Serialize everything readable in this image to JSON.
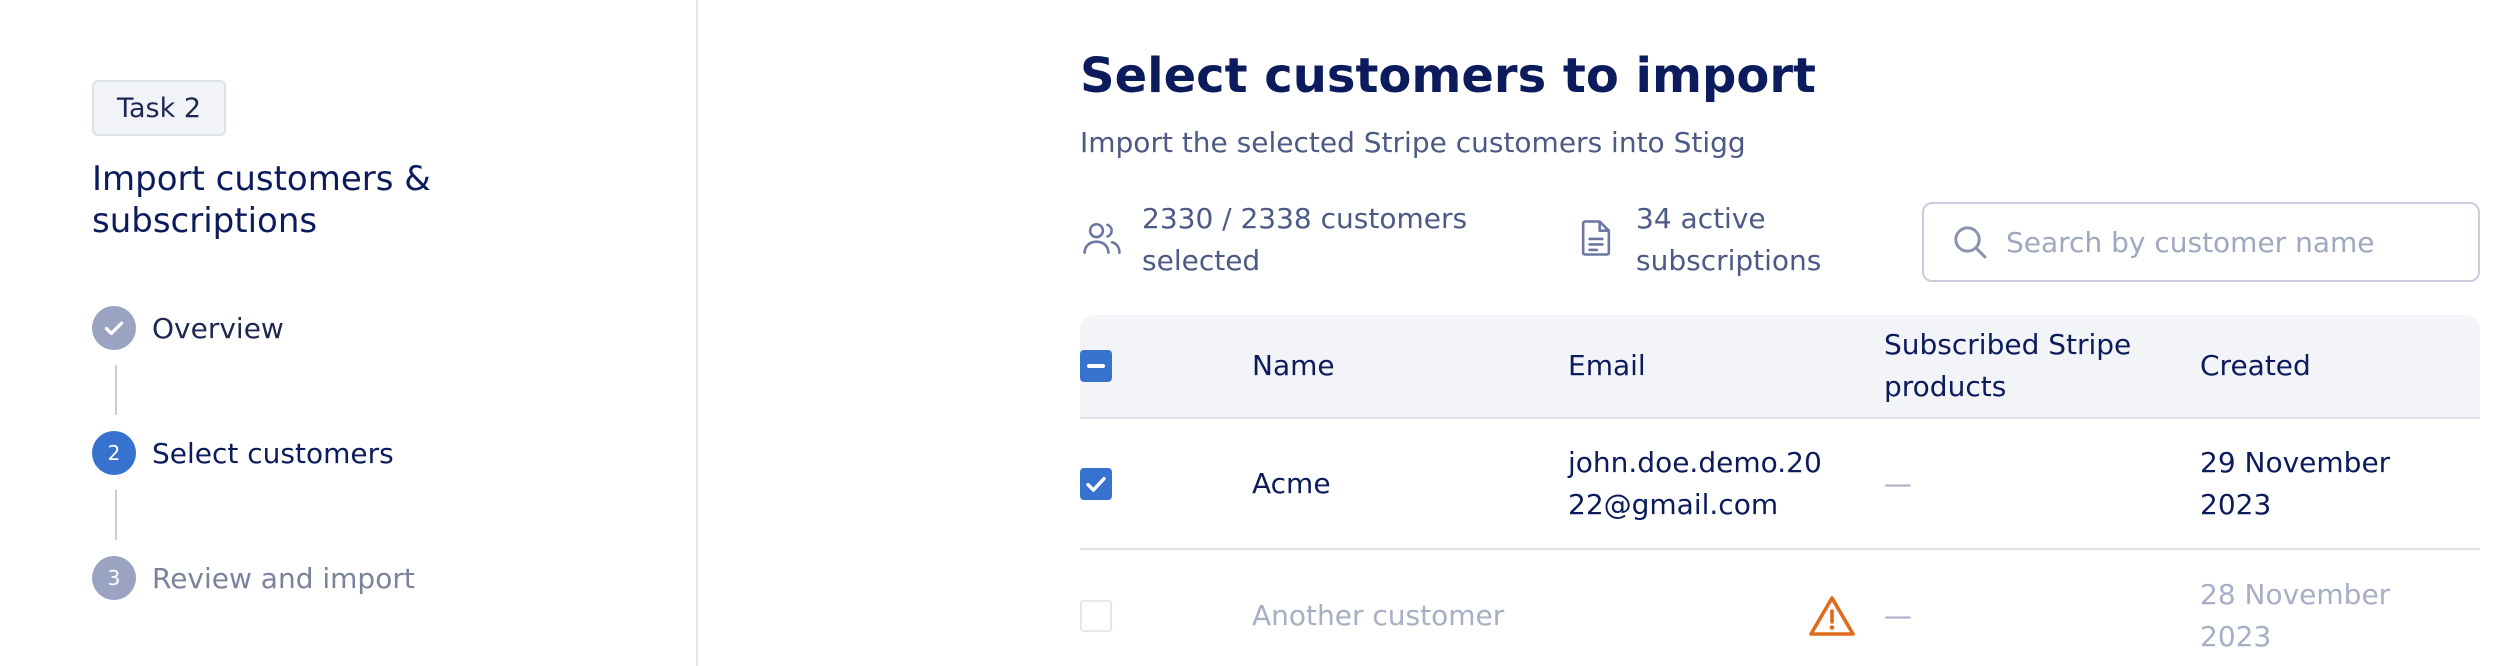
{
  "sidebar": {
    "task_badge": "Task 2",
    "task_title": "Import customers & subscriptions",
    "steps": [
      {
        "number": "",
        "label": "Overview",
        "status": "completed"
      },
      {
        "number": "2",
        "label": "Select customers",
        "status": "active"
      },
      {
        "number": "3",
        "label": "Review and import",
        "status": "pending"
      }
    ]
  },
  "main": {
    "title": "Select customers to import",
    "subtitle": "Import the selected Stripe customers into Stigg",
    "stats": {
      "customers": "2330 / 2338 customers selected",
      "subscriptions": "34 active subscriptions"
    },
    "search": {
      "placeholder": "Search by customer name",
      "value": ""
    }
  },
  "table": {
    "columns": [
      "Name",
      "Email",
      "Subscribed Stripe products",
      "Created"
    ],
    "rows": [
      {
        "name": "Acme",
        "email": "john.doe.demo.2022@gmail.com",
        "products": "—",
        "created": "29 November 2023",
        "checked": true,
        "disabled": false
      },
      {
        "name": "Another customer",
        "email": "",
        "products": "—",
        "created": "28 November 2023",
        "checked": false,
        "disabled": true,
        "warning": "warning-icon"
      }
    ]
  },
  "colors": {
    "accent": "#3872cf",
    "title": "#0b1b5c",
    "muted": "#4c5a85",
    "step_done": "#9aa3c2",
    "warning": "#e06a1b"
  }
}
